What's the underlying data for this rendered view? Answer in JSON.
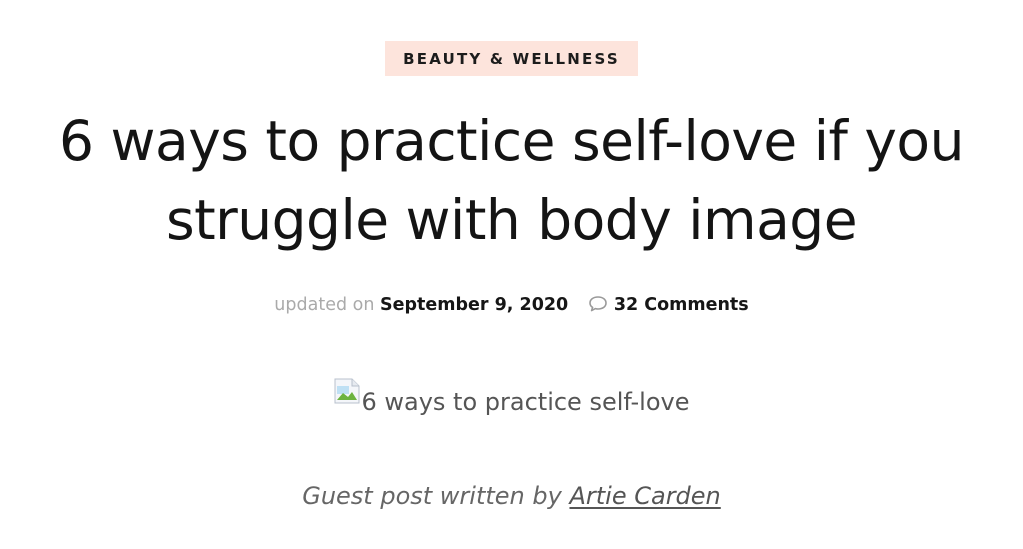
{
  "category": {
    "label": "BEAUTY & WELLNESS"
  },
  "post": {
    "title": "6 ways to practice self-love if you struggle with body image",
    "meta": {
      "updated_prefix": "updated on",
      "date": "September 9, 2020",
      "comments": "32 Comments",
      "comment_icon": "speech-bubble-icon"
    },
    "hero_image": {
      "alt_text": "6 ways to practice self-love",
      "icon": "broken-image-icon"
    },
    "byline": {
      "prefix": "Guest post written by",
      "author": "Artie Carden"
    }
  },
  "colors": {
    "category_bg": "#fde4dc",
    "title_text": "#141414",
    "muted_text": "#aaaaaa",
    "byline_text": "#666666"
  }
}
